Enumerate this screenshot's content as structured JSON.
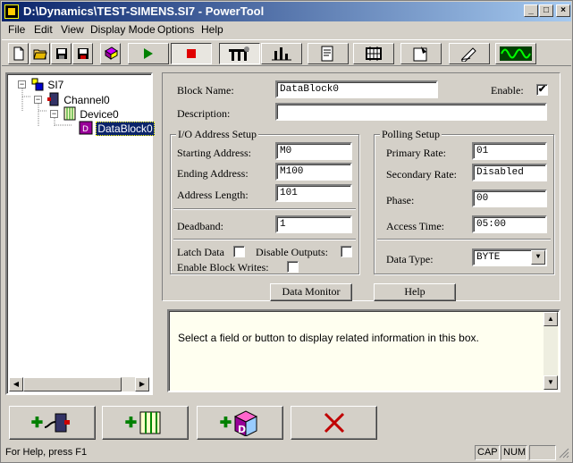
{
  "window": {
    "title": "D:\\Dynamics\\TEST-SIMENS.SI7 - PowerTool",
    "minimize": "_",
    "maximize": "□",
    "close": "×"
  },
  "menu": [
    {
      "label": "File"
    },
    {
      "label": "Edit"
    },
    {
      "label": "View"
    },
    {
      "label": "Display Mode"
    },
    {
      "label": "Options"
    },
    {
      "label": "Help"
    }
  ],
  "toolbar_icons": [
    "new-file-icon",
    "open-folder-icon",
    "save-icon",
    "save-all-icon",
    "book-icon",
    "play-icon",
    "stop-icon",
    "tools-icon",
    "bar-chart-icon",
    "properties-icon",
    "network-icon",
    "settings-sheet-icon",
    "pen-icon",
    "waveform-icon"
  ],
  "tree": {
    "root": "SI7",
    "channel": "Channel0",
    "device": "Device0",
    "block": "DataBlock0"
  },
  "form": {
    "block_name_label": "Block Name:",
    "block_name": "DataBlock0",
    "enable_label": "Enable:",
    "enable_checked": "✔",
    "description_label": "Description:",
    "description": "",
    "io_group": "I/O Address Setup",
    "starting_address_label": "Starting Address:",
    "starting_address": "M0",
    "ending_address_label": "Ending Address:",
    "ending_address": "M100",
    "address_length_label": "Address Length:",
    "address_length": "101",
    "deadband_label": "Deadband:",
    "deadband": "1",
    "latch_data_label": "Latch Data",
    "disable_outputs_label": "Disable Outputs:",
    "enable_block_writes_label": "Enable Block Writes:",
    "polling_group": "Polling Setup",
    "primary_rate_label": "Primary Rate:",
    "primary_rate": "01",
    "secondary_rate_label": "Secondary Rate:",
    "secondary_rate": "Disabled",
    "phase_label": "Phase:",
    "phase": "00",
    "access_time_label": "Access Time:",
    "access_time": "05:00",
    "data_type_label": "Data Type:",
    "data_type": "BYTE"
  },
  "buttons": {
    "data_monitor": "Data Monitor",
    "help": "Help"
  },
  "info_text": "Select a field or button to display related information in this box.",
  "status": {
    "main": "For Help, press F1",
    "cap": "CAP",
    "num": "NUM"
  },
  "colors": {
    "title_start": "#0a246a",
    "title_end": "#a6caf0",
    "selection": "#0a246a",
    "info_bg": "#fffff0"
  }
}
